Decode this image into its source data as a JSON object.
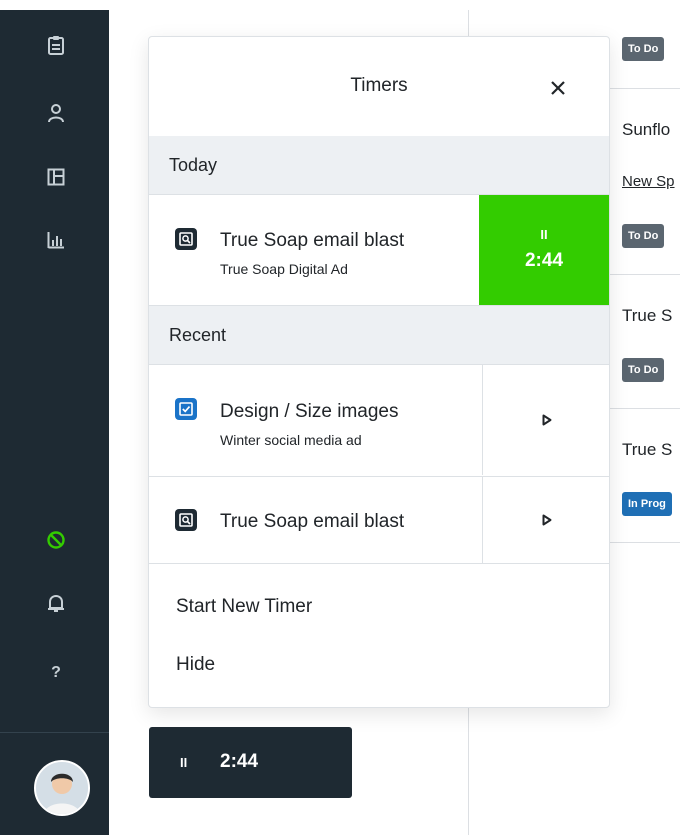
{
  "sidebar": {
    "icons": [
      "clipboard-icon",
      "user-icon",
      "layout-icon",
      "bar-chart-icon",
      "no-entry-icon",
      "bell-icon",
      "help-icon"
    ],
    "help_label": "?",
    "active_color": "#33cc00"
  },
  "background_list": {
    "items": [
      {
        "badge": "To Do"
      },
      {
        "title": "Sunflo",
        "link": "New Sp",
        "badge": "To Do"
      },
      {
        "title": "True S",
        "badge": "To Do"
      },
      {
        "title": "True S",
        "badge": "In Prog"
      }
    ]
  },
  "timers_panel": {
    "title": "Timers",
    "close_label": "×",
    "today": {
      "heading": "Today",
      "rows": [
        {
          "title": "True Soap email blast",
          "subtitle": "True Soap Digital Ad",
          "pause_label": "II",
          "time": "2:44"
        }
      ]
    },
    "recent": {
      "heading": "Recent",
      "rows": [
        {
          "title": "Design / Size images",
          "subtitle": "Winter social media ad"
        },
        {
          "title": "True Soap email blast",
          "subtitle": ""
        }
      ]
    },
    "footer": {
      "start_new": "Start New Timer",
      "hide": "Hide"
    }
  },
  "running_timer": {
    "pause_label": "II",
    "time": "2:44"
  },
  "colors": {
    "sidebar_bg": "#1e2a33",
    "running_green": "#33cc00",
    "task_blue": "#1a73c8",
    "badge_gray": "#5b6670",
    "badge_blue": "#1f6fb5"
  }
}
